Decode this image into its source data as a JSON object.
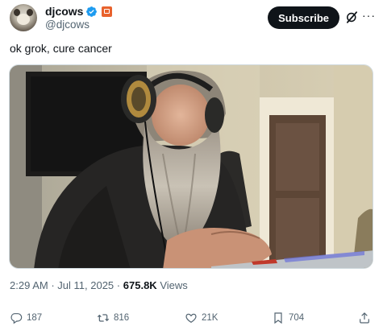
{
  "author": {
    "display_name": "djcows",
    "handle": "@djcows"
  },
  "header": {
    "subscribe_label": "Subscribe"
  },
  "tweet": {
    "text": "ok grok, cure cancer"
  },
  "meta": {
    "time": "2:29 AM",
    "separator1": "·",
    "date": "Jul 11, 2025",
    "separator2": "·",
    "views_count": "675.8K",
    "views_label": "Views"
  },
  "actions": {
    "replies": "187",
    "reposts": "816",
    "likes": "21K",
    "bookmarks": "704"
  },
  "icons": {
    "verified": "verified-badge-icon",
    "affiliate": "affiliate-badge-icon",
    "grok": "grok-icon",
    "more": "more-icon",
    "reply": "reply-icon",
    "repost": "repost-icon",
    "like": "like-icon",
    "bookmark": "bookmark-icon",
    "share": "share-icon"
  },
  "colors": {
    "verified_blue": "#1d9bf0",
    "affiliate_orange": "#e8622d",
    "subscribe_bg": "#0f1419",
    "muted_text": "#536471"
  }
}
